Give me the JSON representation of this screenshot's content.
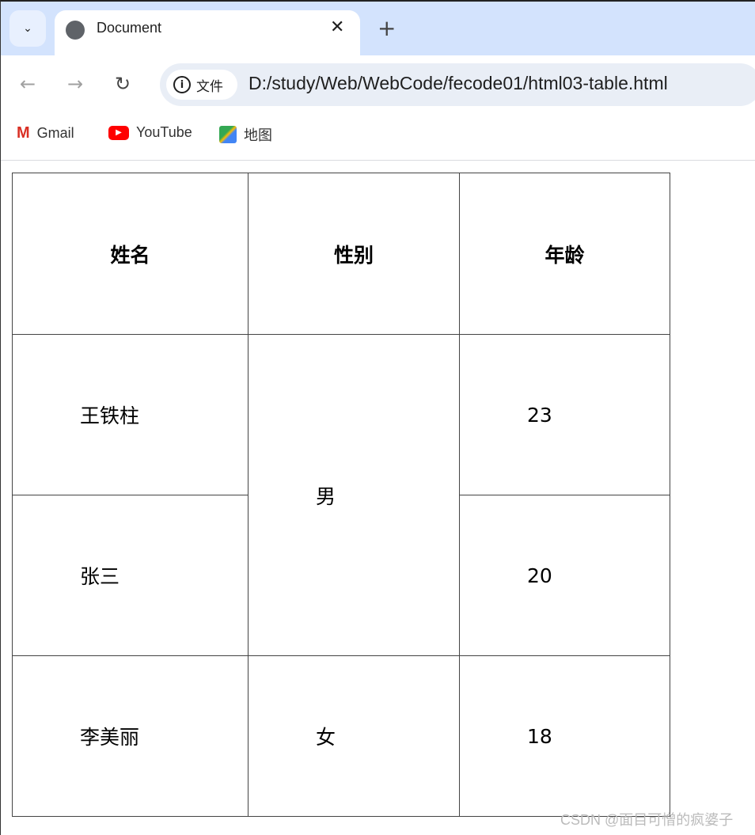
{
  "browser": {
    "tab_title": "Document",
    "address_chip": "文件",
    "url": "D:/study/Web/WebCode/fecode01/html03-table.html",
    "bookmarks": [
      {
        "label": "Gmail",
        "icon": "gmail-icon"
      },
      {
        "label": "YouTube",
        "icon": "youtube-icon"
      },
      {
        "label": "地图",
        "icon": "maps-icon"
      }
    ]
  },
  "table": {
    "headers": [
      "姓名",
      "性别",
      "年龄"
    ],
    "rows": [
      {
        "name": "王铁柱",
        "gender": "男",
        "age": "23"
      },
      {
        "name": "张三",
        "age": "20"
      },
      {
        "name": "李美丽",
        "gender": "女",
        "age": "18"
      }
    ]
  },
  "watermark": "CSDN @面目可憎的疯婆子"
}
